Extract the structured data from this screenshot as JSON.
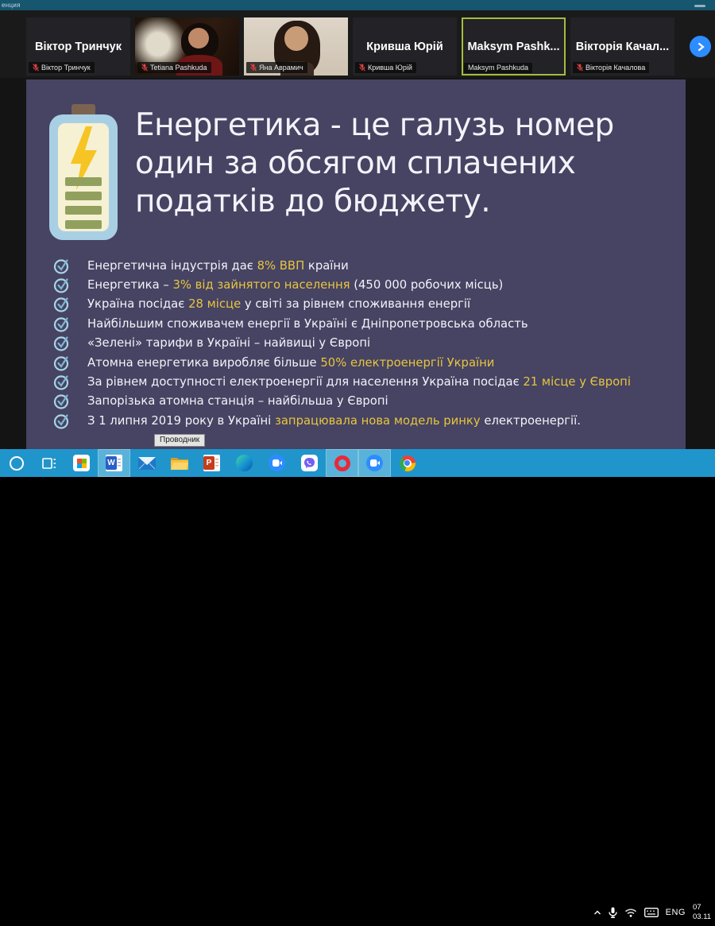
{
  "titlebar": {
    "text": "енция"
  },
  "participants": [
    {
      "name": "Віктор Тринчук",
      "label": "Віктор Тринчук",
      "muted": true,
      "video": "none",
      "active": false
    },
    {
      "name": "",
      "label": "Tetiana Pashkuda",
      "muted": true,
      "video": "portrait-dark",
      "active": false
    },
    {
      "name": "",
      "label": "Яна Аврамич",
      "muted": true,
      "video": "portrait-light",
      "active": false
    },
    {
      "name": "Кривша Юрій",
      "label": "Кривша Юрій",
      "muted": true,
      "video": "none",
      "active": false
    },
    {
      "name": "Maksym  Pashk...",
      "label": "Maksym Pashkuda",
      "muted": false,
      "video": "none",
      "active": true
    },
    {
      "name": "Вікторія Качал...",
      "label": "Вікторія Качалова",
      "muted": true,
      "video": "none",
      "active": false
    }
  ],
  "slide": {
    "title_lines": [
      "Енергетика - це галузь номер",
      "один за обсягом сплачених",
      "податків до бюджету."
    ],
    "bullets": [
      [
        {
          "t": "Енергетична індустрія дає ",
          "hl": false
        },
        {
          "t": "8% ВВП",
          "hl": true
        },
        {
          "t": " країни",
          "hl": false
        }
      ],
      [
        {
          "t": "Енергетика – ",
          "hl": false
        },
        {
          "t": "3% від зайнятого населення",
          "hl": true
        },
        {
          "t": " (450 000 робочих місць)",
          "hl": false
        }
      ],
      [
        {
          "t": "Україна посідає ",
          "hl": false
        },
        {
          "t": "28 місце",
          "hl": true
        },
        {
          "t": " у світі за рівнем споживання енергії",
          "hl": false
        }
      ],
      [
        {
          "t": "Найбільшим споживачем енергії в Україні є Дніпропетровська область",
          "hl": false
        }
      ],
      [
        {
          "t": "«Зелені» тарифи в Україні – найвищі у Європі",
          "hl": false
        }
      ],
      [
        {
          "t": "Атомна енергетика виробляє більше ",
          "hl": false
        },
        {
          "t": "50% електроенергії України",
          "hl": true
        }
      ],
      [
        {
          "t": "За рівнем доступності електроенергії для населення Україна посідає ",
          "hl": false
        },
        {
          "t": "21 місце у Європі",
          "hl": true
        }
      ],
      [
        {
          "t": "Запорізька атомна станція – найбільша у Європі",
          "hl": false
        }
      ],
      [
        {
          "t": "З 1 липня 2019 року в Україні ",
          "hl": false
        },
        {
          "t": "запрацювала нова модель ринку",
          "hl": true
        },
        {
          "t": " електроенергії.",
          "hl": false
        }
      ]
    ],
    "colors": {
      "background": "#464363",
      "text": "#f4f2f8",
      "highlight": "#e7c53d",
      "check": "#a7d5e6",
      "check_mark": "#82b4d2"
    }
  },
  "tooltip": {
    "text": "Проводник"
  },
  "taskbar": {
    "items": [
      {
        "icon": "cortana",
        "open": false
      },
      {
        "icon": "task-view",
        "open": false
      },
      {
        "icon": "microsoft-store",
        "open": false
      },
      {
        "icon": "word",
        "open": true
      },
      {
        "icon": "mail",
        "open": false
      },
      {
        "icon": "file-explorer",
        "open": false
      },
      {
        "icon": "powerpoint",
        "open": false
      },
      {
        "icon": "edge",
        "open": false
      },
      {
        "icon": "zoom",
        "open": false
      },
      {
        "icon": "viber",
        "open": false
      },
      {
        "icon": "opera",
        "open": true
      },
      {
        "icon": "zoom-meeting",
        "open": true
      },
      {
        "icon": "chrome",
        "open": false
      }
    ],
    "colors": {
      "bar": "#2095cc",
      "open_highlight": "#58b2da"
    }
  },
  "tray": {
    "language": "ENG",
    "time": "07",
    "date": "03.11"
  }
}
